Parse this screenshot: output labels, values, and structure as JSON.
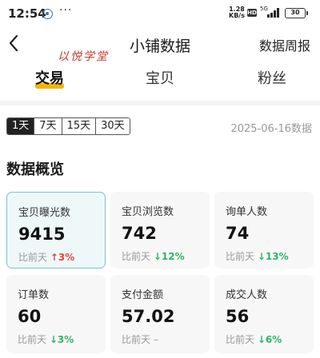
{
  "status_bar": {
    "time": "12:54",
    "more": "···",
    "speed_value": "1.28",
    "speed_unit": "KB/s",
    "hd": "HD",
    "network": "5G",
    "battery": "30"
  },
  "header": {
    "watermark": "以悦学堂",
    "title": "小铺数据",
    "weekly_report": "数据周报"
  },
  "tabs": [
    {
      "label": "交易",
      "active": true
    },
    {
      "label": "宝贝",
      "active": false
    },
    {
      "label": "粉丝",
      "active": false
    }
  ],
  "range": {
    "options": [
      "1天",
      "7天",
      "15天",
      "30天"
    ],
    "selected": "1天",
    "date": "2025-06-16数据"
  },
  "overview": {
    "title": "数据概览",
    "cards": [
      {
        "label": "宝贝曝光数",
        "value": "9415",
        "compare_prefix": "比前天",
        "arrow": "↑",
        "compare": "3%",
        "trend": "up"
      },
      {
        "label": "宝贝浏览数",
        "value": "742",
        "compare_prefix": "比前天",
        "arrow": "↓",
        "compare": "12%",
        "trend": "down"
      },
      {
        "label": "询单人数",
        "value": "74",
        "compare_prefix": "比前天",
        "arrow": "↓",
        "compare": "13%",
        "trend": "down"
      },
      {
        "label": "订单数",
        "value": "60",
        "compare_prefix": "比前天",
        "arrow": "↓",
        "compare": "3%",
        "trend": "down"
      },
      {
        "label": "支付金额",
        "value": "57.02",
        "compare_prefix": "比前天",
        "arrow": "",
        "compare": "–",
        "trend": "flat"
      },
      {
        "label": "成交人数",
        "value": "56",
        "compare_prefix": "比前天",
        "arrow": "↓",
        "compare": "6%",
        "trend": "down"
      }
    ]
  },
  "colors": {
    "accent_yellow": "#f5b400",
    "up_red": "#e64545",
    "down_green": "#2fb46b",
    "active_card_border": "#7cc4cc"
  }
}
